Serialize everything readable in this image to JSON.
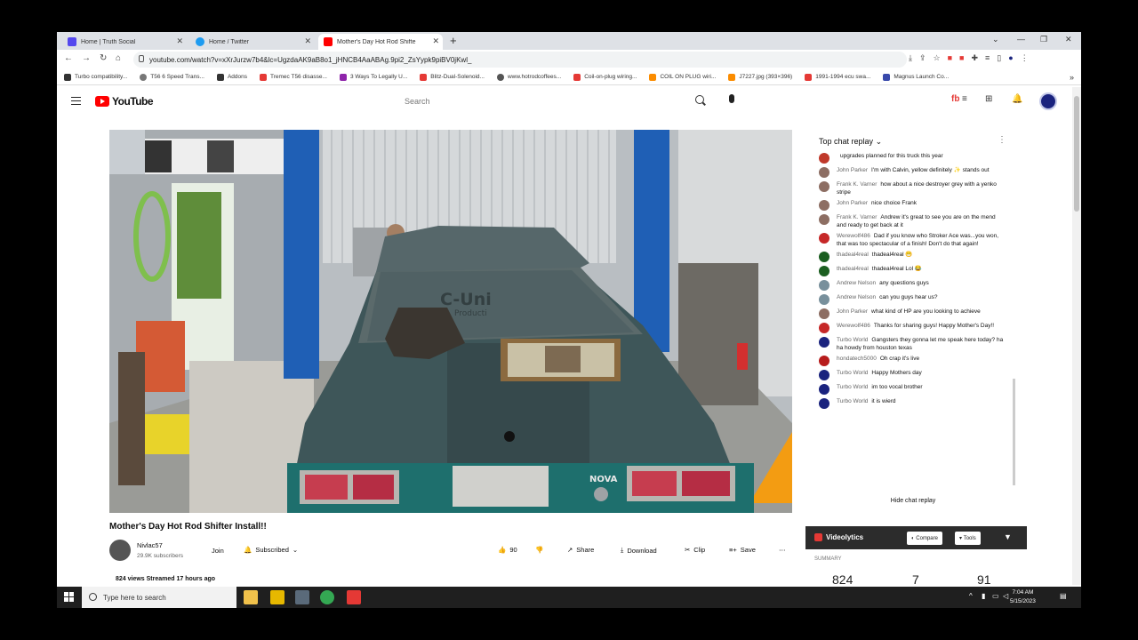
{
  "browser": {
    "tabs": [
      {
        "title": "Home | Truth Social",
        "color": "#5448ee"
      },
      {
        "title": "Home / Twitter",
        "color": "#1d9bf0"
      },
      {
        "title": "Mother's Day Hot Rod Shifte",
        "color": "#ff0000"
      }
    ],
    "url": "youtube.com/watch?v=xXrJurzw7b4&lc=UgzdaAK9aB8o1_jHNCB4AaABAg.9pi2_ZsYypk9piBV0jKwl_",
    "bookmarks": [
      {
        "label": "Turbo compatibility...",
        "color": "#333"
      },
      {
        "label": "T56 6 Speed Trans...",
        "color": "#777"
      },
      {
        "label": "Addons",
        "color": "#333"
      },
      {
        "label": "Tremec T56 disasse...",
        "color": "#e53935"
      },
      {
        "label": "3 Ways To Legally U...",
        "color": "#8e24aa"
      },
      {
        "label": "Blitz-Dual-Solenoid...",
        "color": "#e53935"
      },
      {
        "label": "www.hotrodcoffees...",
        "color": "#555"
      },
      {
        "label": "Coil-on-plug wiring...",
        "color": "#e53935"
      },
      {
        "label": "COIL ON PLUG wiri...",
        "color": "#fb8c00"
      },
      {
        "label": "J7227.jpg (393×396)",
        "color": "#fb8c00"
      },
      {
        "label": "1991-1994 ecu swa...",
        "color": "#e53935"
      },
      {
        "label": "Magnus Launch Co...",
        "color": "#3949ab"
      }
    ]
  },
  "youtube": {
    "logo_text": "YouTube",
    "search_placeholder": "Search",
    "video": {
      "title": "Mother's Day Hot Rod Shifter Install!!",
      "overlay_text_1": "C-Uni",
      "overlay_text_2": "Producti",
      "badge": "NOVA"
    },
    "channel": {
      "name": "Nivlac57",
      "subscribers": "29.9K subscribers"
    },
    "join_label": "Join",
    "subscribed_label": "Subscribed",
    "actions": {
      "likes": "90",
      "share": "Share",
      "download": "Download",
      "clip": "Clip",
      "save": "Save"
    },
    "meta": "824 views  Streamed 17 hours ago"
  },
  "chat": {
    "header": "Top chat replay",
    "hide_label": "Hide chat replay",
    "messages": [
      {
        "author": "",
        "text": "upgrades planned for this truck this year",
        "color": "#c0392b"
      },
      {
        "author": "John Parker",
        "text": "I'm with Calvin, yellow definitely ✨ stands out",
        "color": "#8d6e63"
      },
      {
        "author": "Frank K. Varner",
        "text": "how about a nice destroyer grey with a yenko stripe",
        "color": "#8d6e63"
      },
      {
        "author": "John Parker",
        "text": "nice choice Frank",
        "color": "#8d6e63"
      },
      {
        "author": "Frank K. Varner",
        "text": "Andrew it's great to see you are on the mend and ready to get back at it",
        "color": "#8d6e63"
      },
      {
        "author": "Werewolf486",
        "text": "Dad if you know who Stroker Ace was...you won, that was too spectacular of a finish! Don't do that again!",
        "color": "#c62828"
      },
      {
        "author": "thadeal4real",
        "text": "thadeal4real 😁",
        "color": "#1b5e20"
      },
      {
        "author": "thadeal4real",
        "text": "thadeal4real Lol 😂",
        "color": "#1b5e20"
      },
      {
        "author": "Andrew Nelson",
        "text": "any questions guys",
        "color": "#78909c"
      },
      {
        "author": "Andrew Nelson",
        "text": "can you guys hear us?",
        "color": "#78909c"
      },
      {
        "author": "John Parker",
        "text": "what kind of HP are you looking to achieve",
        "color": "#8d6e63"
      },
      {
        "author": "Werewolf486",
        "text": "Thanks for sharing guys! Happy Mother's Day!!",
        "color": "#c62828"
      },
      {
        "author": "Turbo World",
        "text": "Gangsters they gonna let me speak here today? ha ha howdy from houston texas",
        "color": "#1a237e"
      },
      {
        "author": "hondatech5000",
        "text": "Oh crap it's live",
        "color": "#b71c1c"
      },
      {
        "author": "Turbo World",
        "text": "Happy Mothers day",
        "color": "#1a237e"
      },
      {
        "author": "Turbo World",
        "text": "im too vocal brother",
        "color": "#1a237e"
      },
      {
        "author": "Turbo World",
        "text": "it is wierd",
        "color": "#1a237e"
      }
    ]
  },
  "videolytics": {
    "title": "Videolytics",
    "compare": "Compare",
    "tools": "Tools",
    "summary_label": "SUMMARY",
    "stats": [
      "824",
      "7",
      "91"
    ]
  },
  "taskbar": {
    "search_placeholder": "Type here to search",
    "time": "7:04 AM",
    "date": "5/15/2023"
  }
}
